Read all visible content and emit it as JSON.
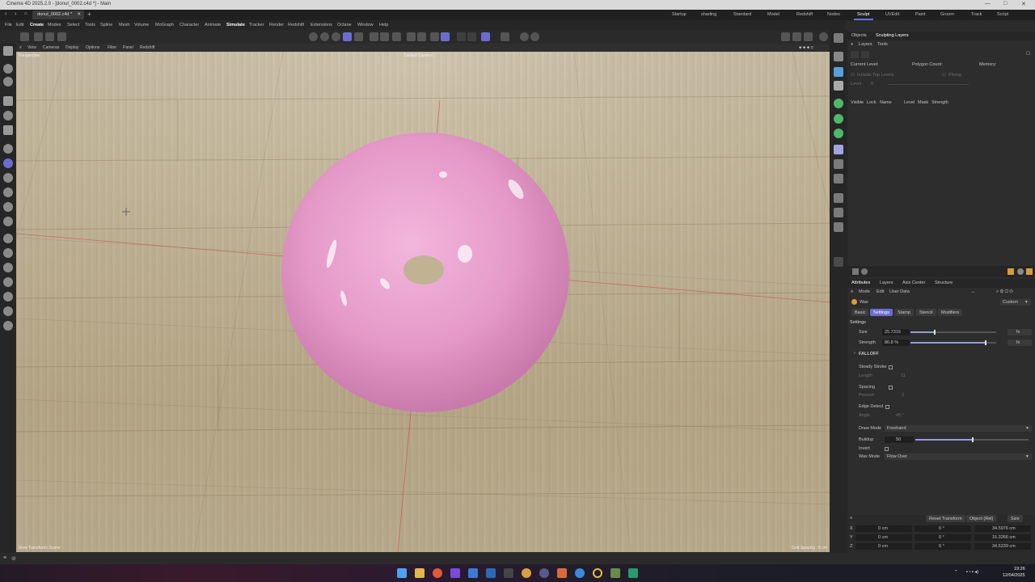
{
  "window": {
    "title": "Cinema 4D 2025.2.0 - [donut_0002.c4d *] - Main",
    "tab": "donut_0002.c4d *"
  },
  "layouts": [
    "Startup",
    "shading",
    "Standard",
    "Model",
    "Redshift",
    "Nodes",
    "Sculpt",
    "UVEdit",
    "Paint",
    "Groom",
    "Track",
    "Script"
  ],
  "active_layout": "Sculpt",
  "menu": [
    "File",
    "Edit",
    "Create",
    "Modes",
    "Select",
    "Tools",
    "Spline",
    "Mesh",
    "Volume",
    "MoGraph",
    "Character",
    "Animate",
    "Simulate",
    "Tracker",
    "Render",
    "Redshift",
    "Extensions",
    "Octane",
    "Window",
    "Help"
  ],
  "viewport": {
    "menu": [
      "View",
      "Cameras",
      "Display",
      "Options",
      "Filter",
      "Panel",
      "Redshift"
    ],
    "projection": "Perspective",
    "camera": "Default Camera ⁘",
    "footer_left": "View Transform: Scene",
    "footer_right": "Grid Spacing : 5 cm"
  },
  "objects_panel": {
    "tabs": [
      "Objects",
      "Sculpting Layers"
    ],
    "subtabs": [
      "Layers",
      "Tools"
    ],
    "current_level": "Current Level:",
    "polygon_count": "Polygon Count:",
    "memory": "Memory:",
    "include_top_levels": "Include Top Levels",
    "phong": "Phong",
    "level_label": "Level",
    "level_value": "0",
    "columns": [
      "Visible",
      "Lock",
      "Name",
      "Level",
      "Mask",
      "Strength"
    ]
  },
  "attributes": {
    "tabs": [
      "Attributes",
      "Layers",
      "Axis Center",
      "Structure"
    ],
    "menu": [
      "Mode",
      "Edit",
      "User Data"
    ],
    "brush_name": "Wax",
    "preset": "Custom",
    "subtabs": [
      "Basic",
      "Settings",
      "Stamp",
      "Stencil",
      "Modifiers"
    ],
    "active_subtab": "Settings",
    "section": "Settings",
    "size_label": "Size",
    "size_value": "25.7316",
    "size_level": 0.27,
    "strength_label": "Strength",
    "strength_value": "86.8 %",
    "strength_level": 0.868,
    "fx": "fx",
    "falloff": "FALLOFF",
    "steady_stroke": "Steady Stroke",
    "length_label": "Length",
    "length_value": "11",
    "spacing": "Spacing",
    "percent_label": "Percent",
    "percent_value": "2",
    "edge_detect": "Edge Detect",
    "angle_label": "Angle",
    "angle_value": "45 °",
    "draw_mode_label": "Draw Mode",
    "draw_mode_value": "Freehand",
    "buildup_label": "Buildup",
    "buildup_value": "50",
    "buildup_level": 0.5,
    "invert": "Invert",
    "wax_mode_label": "Wax Mode",
    "wax_mode_value": "Flow Over"
  },
  "transform": {
    "reset_button": "Reset Transform",
    "mode": "Object (Rel)",
    "size_dropdown": "Size",
    "rows": [
      {
        "axis": "X",
        "pos": "0 cm",
        "rot": "0 °",
        "size": "34.5976 cm"
      },
      {
        "axis": "Y",
        "pos": "0 cm",
        "rot": "0 °",
        "size": "15.3266 cm"
      },
      {
        "axis": "Z",
        "pos": "0 cm",
        "rot": "0 °",
        "size": "34.5239 cm"
      }
    ]
  },
  "taskbar": {
    "time": "19:26",
    "date": "12/04/2025"
  },
  "colors": {
    "accent": "#6c6ccf",
    "donut": "#e59ac8",
    "floor": "#c6b797"
  }
}
